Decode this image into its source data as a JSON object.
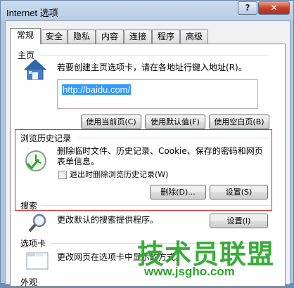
{
  "window": {
    "title": "Internet 选项"
  },
  "tabs": [
    "常规",
    "安全",
    "隐私",
    "内容",
    "连接",
    "程序",
    "高级"
  ],
  "home": {
    "heading": "主页",
    "description": "若要创建主页选项卡，请在各地址行键入地址(R)。",
    "url": "http://baidu.com/",
    "btn_current": "使用当前页(C)",
    "btn_default": "使用默认值(F)",
    "btn_blank": "使用空白页(B)"
  },
  "history": {
    "heading": "浏览历史记录",
    "description_line1": "删除临时文件、历史记录、Cookie、保存的密码和网页",
    "description_line2": "表单信息。",
    "checkbox_label": "退出时删除浏览历史记录(W)",
    "btn_delete": "删除(D)...",
    "btn_settings": "设置(S)"
  },
  "search": {
    "heading": "搜索",
    "description": "更改默认的搜索提供程序。",
    "btn_settings": "设置(I)"
  },
  "tabsection": {
    "heading": "选项卡",
    "description": "更改网页在选项卡中显示的方式。"
  },
  "appearance": {
    "heading": "外观"
  },
  "watermark": {
    "brand": "技术员联盟",
    "url": "www.jsgho.com"
  }
}
